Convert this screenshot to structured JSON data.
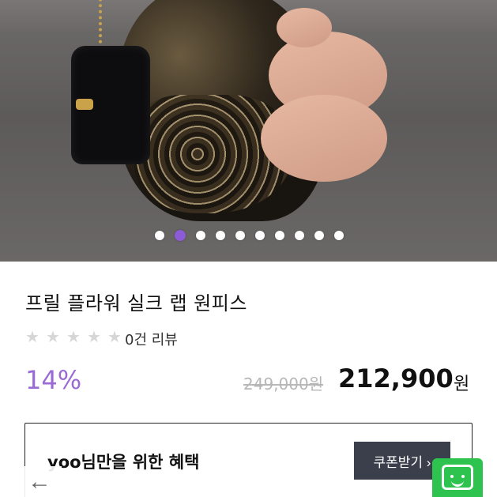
{
  "product": {
    "title": "프릴 플라워 실크 랩 원피스",
    "rating_stars": 0,
    "review_count_text": "0건 리뷰",
    "discount": "14%",
    "original_price": "249,000원",
    "price": "212,900",
    "price_unit": "원"
  },
  "gallery": {
    "total_images": 10,
    "active_index": 1
  },
  "benefit": {
    "text": "yoo님만을 위한 혜택",
    "coupon_button": "쿠폰받기 ›"
  },
  "nav": {
    "back_symbol": "←"
  },
  "colors": {
    "accent": "#9a6ad6",
    "chat": "#2ec24f",
    "coupon_bg": "#3a3f4b"
  },
  "icons": {
    "back": "arrow-left-icon",
    "chat": "chat-bubble-icon",
    "star": "star-icon"
  }
}
